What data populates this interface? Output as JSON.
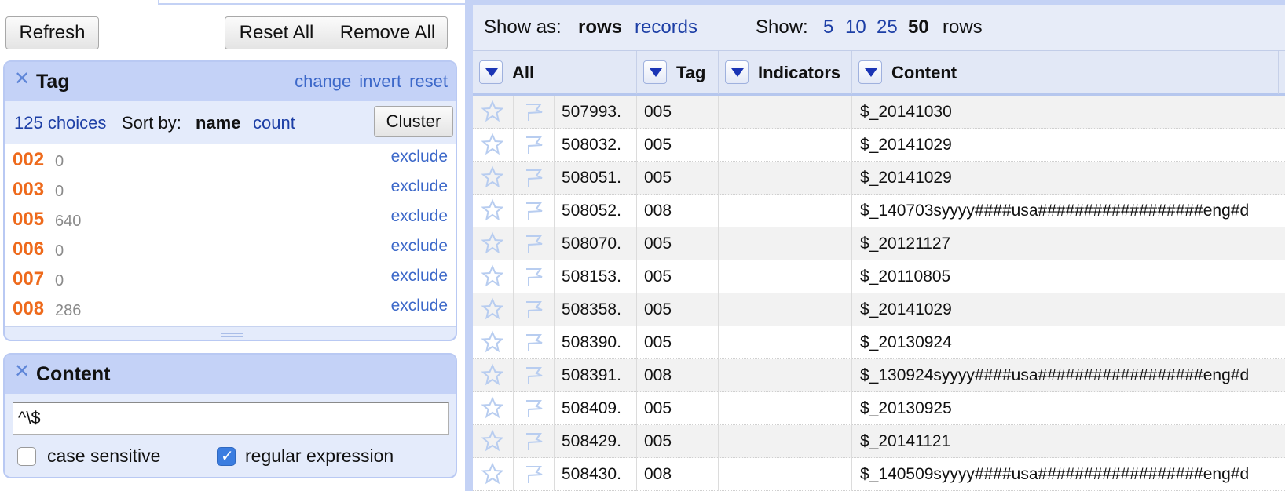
{
  "left": {
    "buttons": {
      "refresh": "Refresh",
      "reset_all": "Reset All",
      "remove_all": "Remove All"
    },
    "tag_facet": {
      "title": "Tag",
      "links": {
        "change": "change",
        "invert": "invert",
        "reset": "reset"
      },
      "choices": "125 choices",
      "sort_by": "Sort by:",
      "sort_name": "name",
      "sort_count": "count",
      "cluster": "Cluster",
      "items": [
        {
          "name": "002",
          "count": "0",
          "action": "exclude"
        },
        {
          "name": "003",
          "count": "0",
          "action": "exclude"
        },
        {
          "name": "005",
          "count": "640",
          "action": "exclude"
        },
        {
          "name": "006",
          "count": "0",
          "action": "exclude"
        },
        {
          "name": "007",
          "count": "0",
          "action": "exclude"
        },
        {
          "name": "008",
          "count": "286",
          "action": "exclude"
        }
      ]
    },
    "content_facet": {
      "title": "Content",
      "input_value": "^\\$",
      "case_sensitive": {
        "label": "case sensitive",
        "checked": false
      },
      "regular_expression": {
        "label": "regular expression",
        "checked": true
      }
    }
  },
  "right": {
    "view_bar": {
      "show_as": "Show as:",
      "rows": "rows",
      "records": "records",
      "show": "Show:",
      "options": [
        "5",
        "10",
        "25",
        "50"
      ],
      "selected": "50",
      "rows_suffix": "rows"
    },
    "columns": [
      "All",
      "Tag",
      "Indicators",
      "Content"
    ],
    "rows": [
      {
        "id": "507993.",
        "tag": "005",
        "indicators": "",
        "content": "$_20141030"
      },
      {
        "id": "508032.",
        "tag": "005",
        "indicators": "",
        "content": "$_20141029"
      },
      {
        "id": "508051.",
        "tag": "005",
        "indicators": "",
        "content": "$_20141029"
      },
      {
        "id": "508052.",
        "tag": "008",
        "indicators": "",
        "content": "$_140703syyyy####usa##################eng#d"
      },
      {
        "id": "508070.",
        "tag": "005",
        "indicators": "",
        "content": "$_20121127"
      },
      {
        "id": "508153.",
        "tag": "005",
        "indicators": "",
        "content": "$_20110805"
      },
      {
        "id": "508358.",
        "tag": "005",
        "indicators": "",
        "content": "$_20141029"
      },
      {
        "id": "508390.",
        "tag": "005",
        "indicators": "",
        "content": "$_20130924"
      },
      {
        "id": "508391.",
        "tag": "008",
        "indicators": "",
        "content": "$_130924syyyy####usa##################eng#d"
      },
      {
        "id": "508409.",
        "tag": "005",
        "indicators": "",
        "content": "$_20130925"
      },
      {
        "id": "508429.",
        "tag": "005",
        "indicators": "",
        "content": "$_20141121"
      },
      {
        "id": "508430.",
        "tag": "008",
        "indicators": "",
        "content": "$_140509syyyy####usa##################eng#d"
      }
    ]
  },
  "colors": {
    "accent_orange": "#ee6a1c",
    "link_blue": "#1d3fa6",
    "facet_header": "#c4d2f7"
  },
  "icons": {
    "row_star": "star-icon",
    "row_flag": "flag-icon",
    "column_menu": "chevron-down-icon",
    "facet_close": "close-icon"
  }
}
